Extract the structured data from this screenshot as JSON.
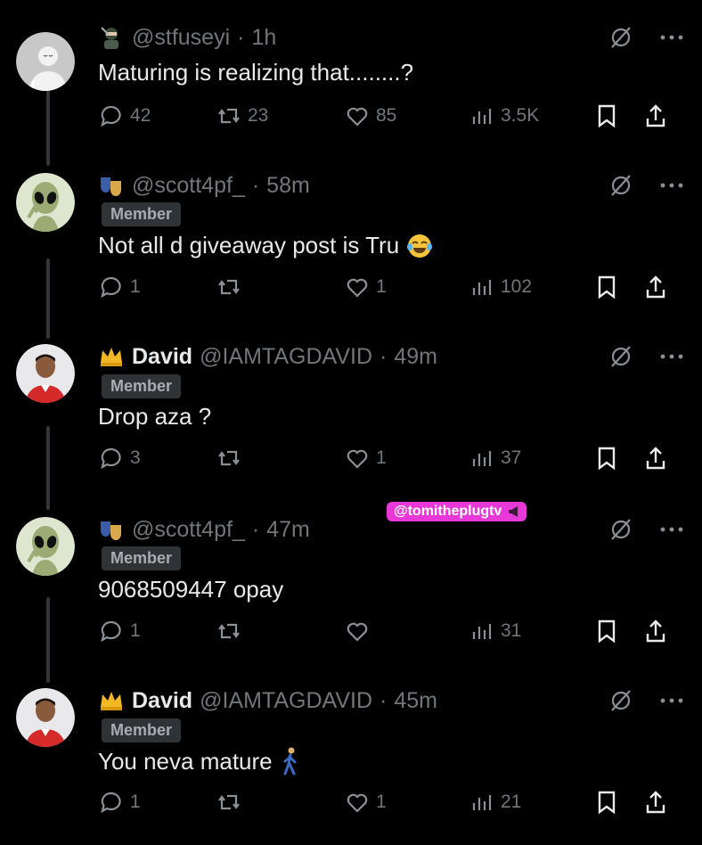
{
  "thread": {
    "posts": [
      {
        "handle": "@stfuseyi",
        "dot": "·",
        "time": "1h",
        "display_name": "",
        "member_label": "",
        "text": "Maturing is realizing that........?",
        "avatar": "default-avatar",
        "badge_icon": "ninja-emoji",
        "metrics": {
          "replies": "42",
          "reposts": "23",
          "likes": "85",
          "views": "3.5K"
        }
      },
      {
        "handle": "@scott4pf_",
        "dot": "·",
        "time": "58m",
        "display_name": "",
        "member_label": "Member",
        "text": "Not all d giveaway post is Tru",
        "text_emoji": "laughing-emoji",
        "avatar": "alien-avatar",
        "badge_icon": "mask-emoji",
        "metrics": {
          "replies": "1",
          "reposts": "",
          "likes": "1",
          "views": "102"
        }
      },
      {
        "handle": "@IAMTAGDAVID",
        "dot": "·",
        "time": "49m",
        "display_name": "David",
        "member_label": "Member",
        "text": "Drop aza ?",
        "avatar": "person-avatar",
        "badge_icon": "crown-emoji",
        "metrics": {
          "replies": "3",
          "reposts": "",
          "likes": "1",
          "views": "37"
        }
      },
      {
        "handle": "@scott4pf_",
        "dot": "·",
        "time": "47m",
        "display_name": "",
        "member_label": "Member",
        "text": "9068509447 opay",
        "avatar": "alien-avatar",
        "badge_icon": "mask-emoji",
        "metrics": {
          "replies": "1",
          "reposts": "",
          "likes": "",
          "views": "31"
        }
      },
      {
        "handle": "@IAMTAGDAVID",
        "dot": "·",
        "time": "45m",
        "display_name": "David",
        "member_label": "Member",
        "text": "You neva mature",
        "text_emoji": "walking-person-emoji",
        "avatar": "person-avatar",
        "badge_icon": "crown-emoji",
        "metrics": {
          "replies": "1",
          "reposts": "",
          "likes": "1",
          "views": "21"
        }
      }
    ]
  },
  "watermark": {
    "text": "@tomitheplugtv"
  },
  "colors": {
    "background": "#000000",
    "text": "#e7e9ea",
    "muted": "#71767b",
    "watermark": "#e838d8"
  }
}
